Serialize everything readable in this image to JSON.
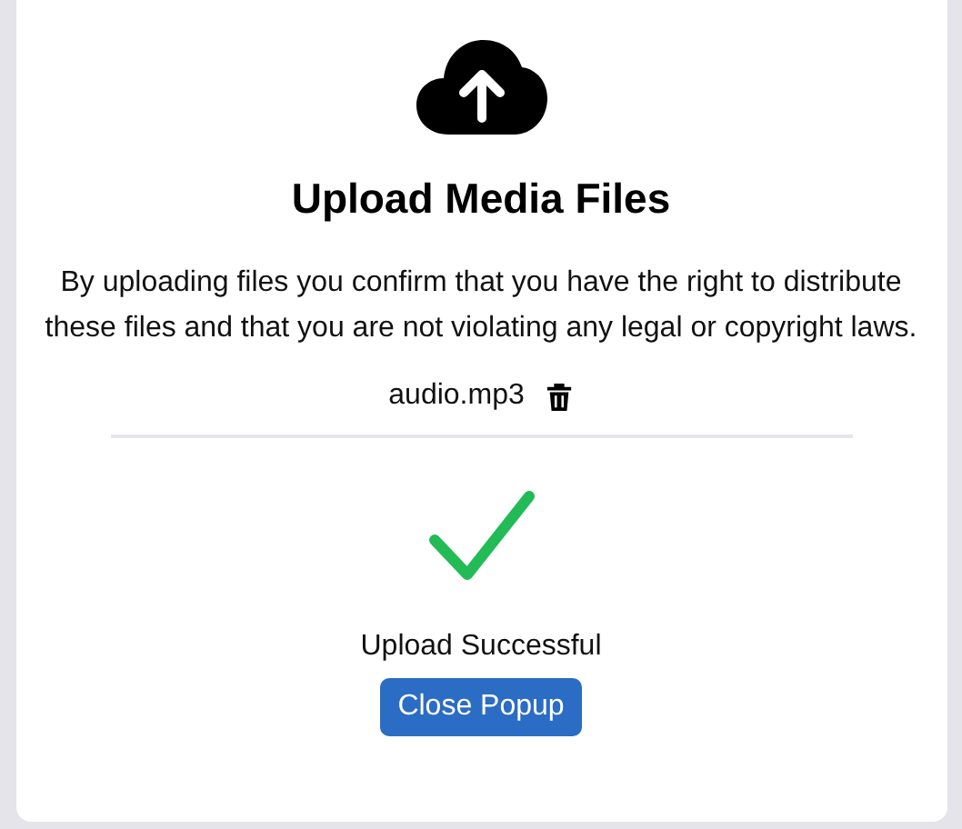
{
  "dialog": {
    "title": "Upload Media Files",
    "notice": "By uploading files you confirm that you have the right to distribute these files and that you are not violating any legal or copyright laws.",
    "files": [
      {
        "name": "audio.mp3"
      }
    ],
    "status": {
      "kind": "success",
      "message": "Upload Successful"
    },
    "button": "Close Popup"
  }
}
